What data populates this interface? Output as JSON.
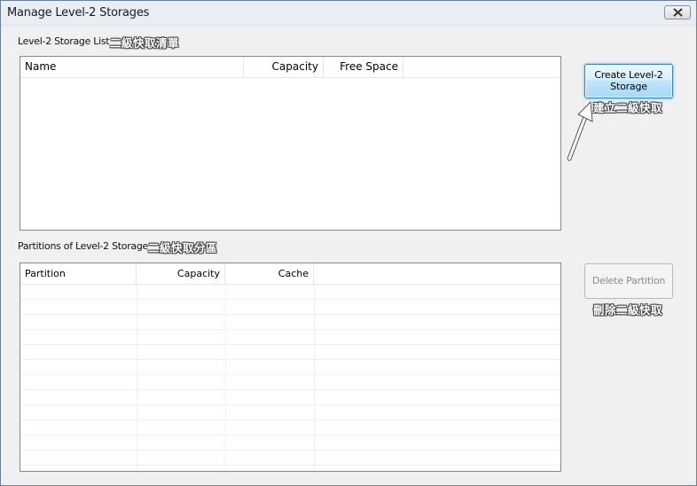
{
  "window": {
    "title": "Manage Level-2 Storages"
  },
  "storage_list": {
    "label": "Level-2 Storage List",
    "annotation": "二級快取清單",
    "columns": [
      "Name",
      "Capacity",
      "Free Space"
    ],
    "rows": []
  },
  "partitions": {
    "label": "Partitions of Level-2 Storage",
    "annotation": "二級快取分區",
    "columns": [
      "Partition",
      "Capacity",
      "Cache"
    ],
    "rows": []
  },
  "buttons": {
    "create_label": "Create Level-2 Storage",
    "create_annotation": "建立二級快取",
    "delete_label": "Delete Partition",
    "delete_annotation": "刪除二級快取"
  }
}
